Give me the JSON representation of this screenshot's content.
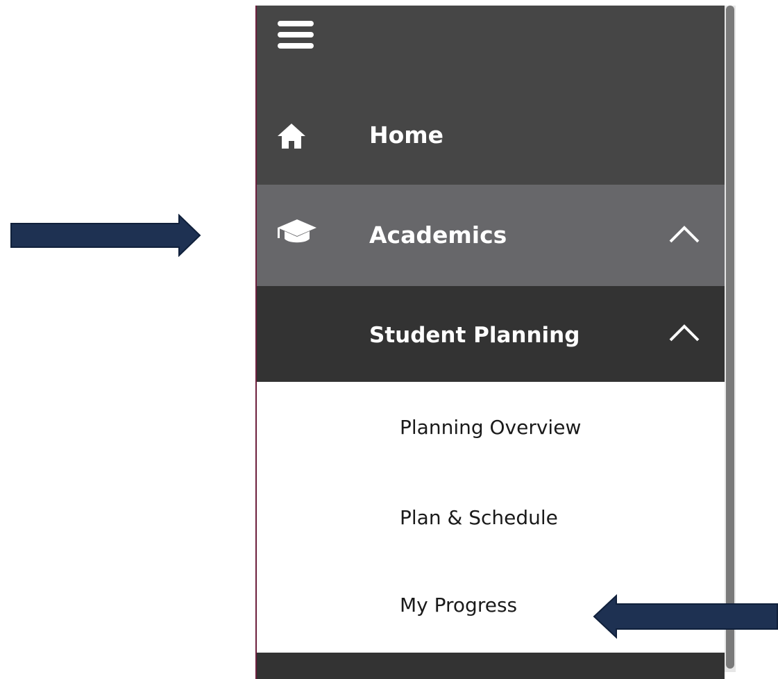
{
  "colors": {
    "sidebar_bg": "#464646",
    "selected_row_bg": "#67676a",
    "subheader_bg": "#333333",
    "submenu_bg": "#ffffff",
    "arrow_fill": "#1e3152",
    "accent_border": "#6d1f3d"
  },
  "sidebar": {
    "menu_icon": "hamburger-menu-icon",
    "items": [
      {
        "label": "Home",
        "icon": "home-icon"
      },
      {
        "label": "Academics",
        "icon": "graduation-cap-icon",
        "expanded": true,
        "chevron": "chevron-up-icon"
      }
    ],
    "subsection": {
      "label": "Student Planning",
      "expanded": true,
      "chevron": "chevron-up-icon",
      "items": [
        {
          "label": "Planning Overview"
        },
        {
          "label": "Plan & Schedule"
        },
        {
          "label": "My Progress"
        }
      ]
    }
  },
  "annotations": [
    {
      "icon": "right-arrow-icon",
      "points_to": "Academics"
    },
    {
      "icon": "left-arrow-icon",
      "points_to": "My Progress"
    }
  ]
}
